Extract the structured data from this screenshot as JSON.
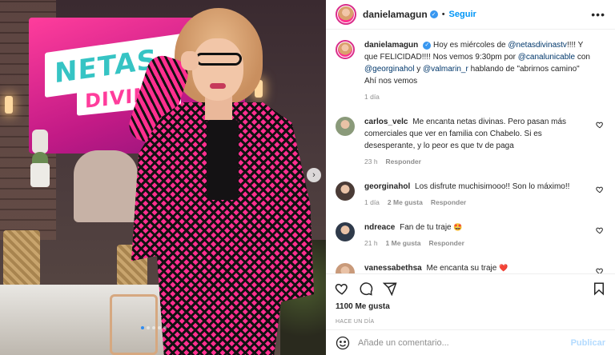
{
  "post": {
    "author": "danielamagun",
    "follow_label": "Seguir",
    "more_icon": "more-horizontal-icon",
    "verified_icon": "verified-badge-icon",
    "image_alt_overlay": {
      "logo_line1": "NETAS",
      "logo_line2": "DIVINAS"
    }
  },
  "caption": {
    "user": "danielamagun",
    "parts": {
      "t1": "Hoy es miércoles de ",
      "m1": "@netasdivinastv",
      "t2": "!!!! Y que FELICIDAD!!!! Nos vemos 9:30pm por ",
      "m2": "@canalunicable",
      "t3": " con ",
      "m3": "@georginahol",
      "t4": " y ",
      "m4": "@valmarin_r",
      "t5": " hablando de \"abrirnos camino\" Ahí nos vemos"
    },
    "time": "1 día"
  },
  "comments": [
    {
      "user": "carlos_velc",
      "text": "Me encanta netas divinas. Pero pasan más comerciales que ver en familia con Chabelo. Si es desesperante, y lo peor es que tv de paga",
      "time": "23 h",
      "likes": "",
      "reply": "Responder",
      "avatar_color": "#8a9a7a"
    },
    {
      "user": "georginahol",
      "text": "Los disfrute muchisimooo!! Son lo máximo!!",
      "time": "1 día",
      "likes": "2 Me gusta",
      "reply": "Responder",
      "avatar_color": "#4a3b36"
    },
    {
      "user": "ndreace",
      "text": "Fan de tu traje",
      "emoji": "🤩",
      "time": "21 h",
      "likes": "1 Me gusta",
      "reply": "Responder",
      "avatar_color": "#2f3a4a"
    },
    {
      "user": "vanessabethsa",
      "text": "Me encanta su traje",
      "emoji": "❤️",
      "time": "",
      "likes": "",
      "reply": "",
      "avatar_color": "#c99a7a"
    }
  ],
  "actions": {
    "like_icon": "heart-icon",
    "comment_icon": "comment-icon",
    "share_icon": "send-icon",
    "save_icon": "bookmark-icon"
  },
  "likes_count": "1100 Me gusta",
  "posted_ago": "HACE UN DÍA",
  "add_comment": {
    "placeholder": "Añade un comentario...",
    "publish_label": "Publicar",
    "emoji_icon": "smiley-icon"
  },
  "colors": {
    "accent_blue": "#0095f6",
    "publish_disabled": "#b3dbff",
    "mention": "#00376b",
    "muted": "#8e8e8e"
  }
}
